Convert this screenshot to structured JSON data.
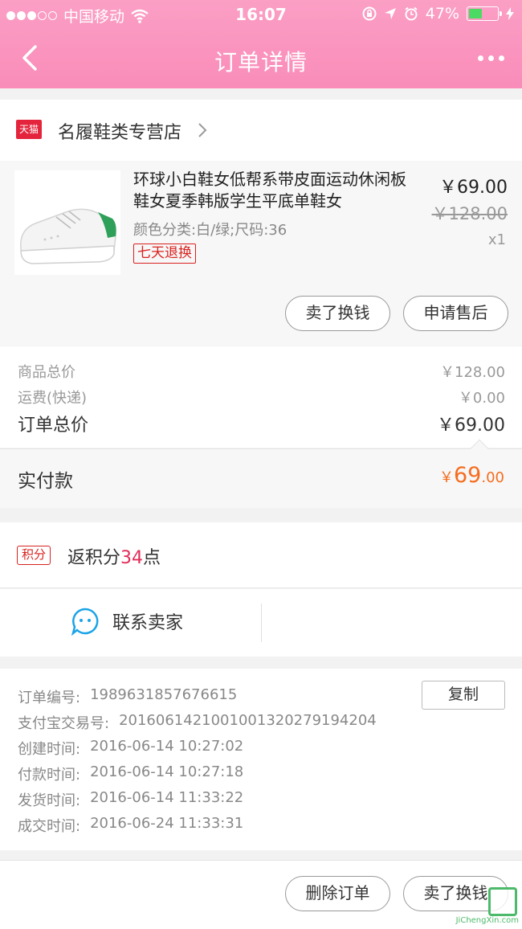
{
  "status_bar": {
    "carrier": "中国移动",
    "time": "16:07",
    "battery": "47%",
    "battery_level": 0.47
  },
  "header": {
    "title": "订单详情"
  },
  "shop": {
    "badge": "天猫",
    "name": "名履鞋类专营店"
  },
  "product": {
    "title": "环球小白鞋女低帮系带皮面运动休闲板鞋女夏季韩版学生平底单鞋女",
    "spec": "颜色分类:白/绿;尺码:36",
    "tag": "七天退换",
    "price": "￥69.00",
    "original_price": "￥128.00",
    "quantity": "x1",
    "actions": [
      "卖了换钱",
      "申请售后"
    ]
  },
  "costs": {
    "goods_label": "商品总价",
    "goods_value": "￥128.00",
    "shipping_label": "运费(快递)",
    "shipping_value": "￥0.00",
    "order_label": "订单总价",
    "order_value": "￥69.00"
  },
  "paid": {
    "label": "实付款",
    "symbol": "￥",
    "integer": "69",
    "decimal": ".00"
  },
  "points": {
    "badge": "积分",
    "prefix": "返积分",
    "number": "34",
    "suffix": "点"
  },
  "contact": {
    "label": "联系卖家"
  },
  "order_info": {
    "copy_label": "复制",
    "rows": [
      {
        "label": "订单编号:",
        "value": "1989631857676615"
      },
      {
        "label": "支付宝交易号:",
        "value": "2016061421001001320279194204"
      },
      {
        "label": "创建时间:",
        "value": "2016-06-14 10:27:02"
      },
      {
        "label": "付款时间:",
        "value": "2016-06-14 10:27:18"
      },
      {
        "label": "发货时间:",
        "value": "2016-06-14 11:33:22"
      },
      {
        "label": "成交时间:",
        "value": "2016-06-24 11:33:31"
      }
    ]
  },
  "bottom_actions": [
    "删除订单",
    "卖了换钱"
  ],
  "watermark": {
    "text": "JiChengXin.com"
  },
  "colors": {
    "header_pink": "#f98cb9",
    "accent_orange": "#f56d1f",
    "tag_red": "#d8221f",
    "points_pink": "#e22c5a"
  }
}
